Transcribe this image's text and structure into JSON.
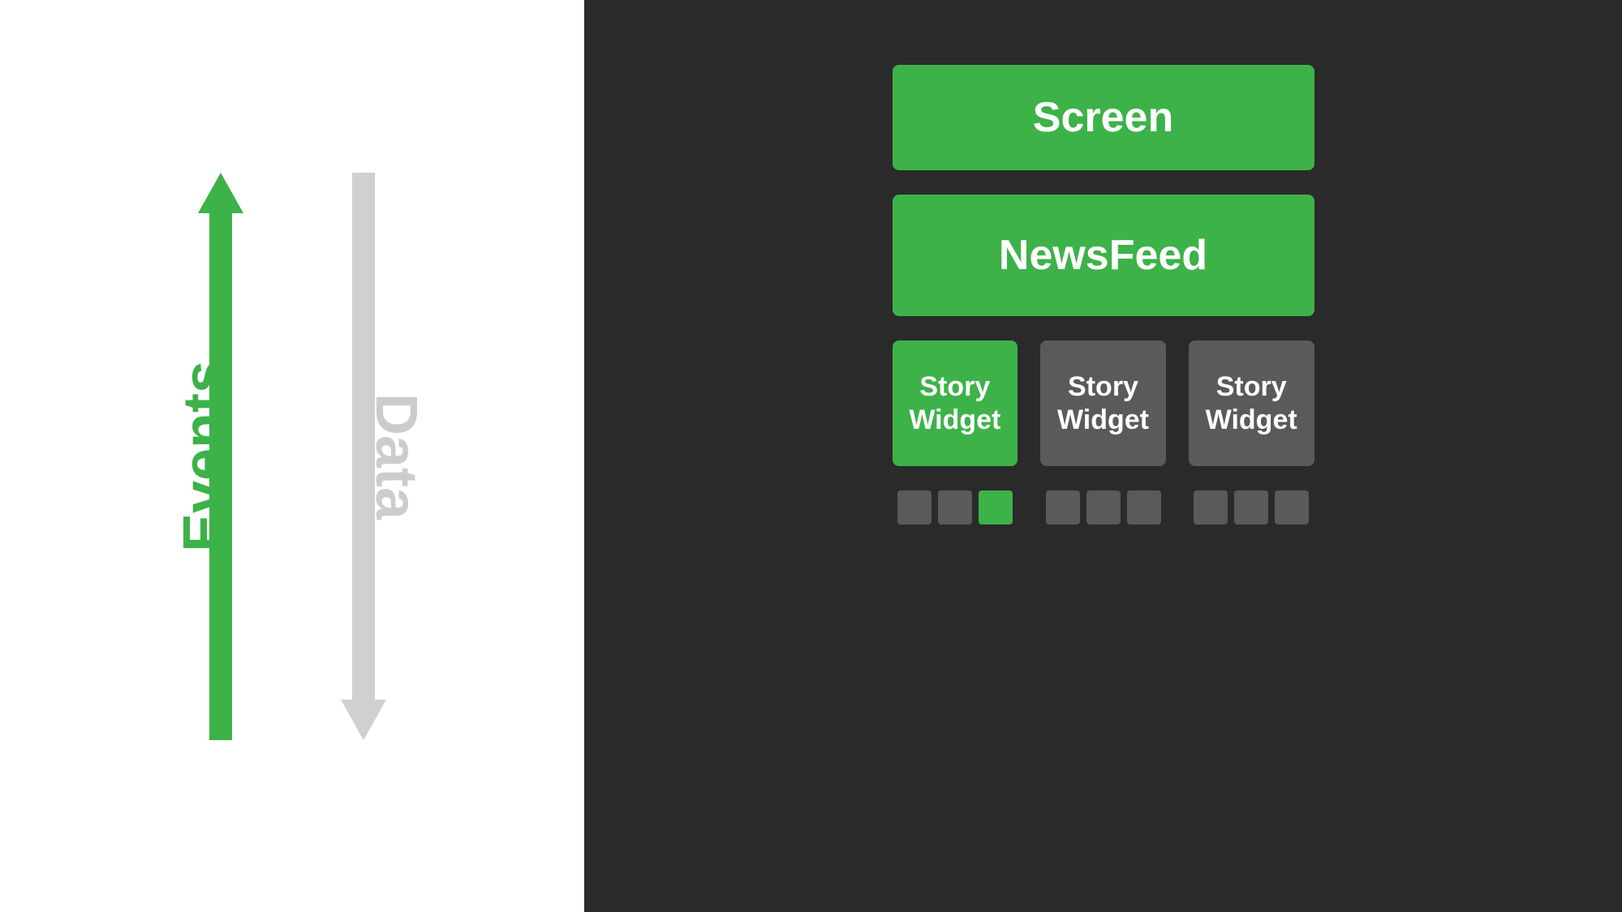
{
  "left_panel": {
    "events_label": "Events",
    "data_label": "Data"
  },
  "right_panel": {
    "screen_label": "Screen",
    "newsfeed_label": "NewsFeed",
    "story_widgets": [
      {
        "label": "Story\nWidget",
        "type": "green"
      },
      {
        "label": "Story\nWidget",
        "type": "gray"
      },
      {
        "label": "Story\nWidget",
        "type": "gray"
      }
    ],
    "indicator_groups": [
      [
        {
          "type": "gray"
        },
        {
          "type": "gray"
        },
        {
          "type": "green"
        }
      ],
      [
        {
          "type": "gray"
        },
        {
          "type": "gray"
        },
        {
          "type": "gray"
        }
      ],
      [
        {
          "type": "gray"
        },
        {
          "type": "gray"
        },
        {
          "type": "gray"
        }
      ]
    ]
  },
  "colors": {
    "green": "#3db249",
    "dark_bg": "#2a2a2a",
    "gray_widget": "#5a5a5a",
    "gray_indicator": "#5a5a5a",
    "light_gray_arrow": "#d0d0d0",
    "white_bg": "#ffffff"
  }
}
